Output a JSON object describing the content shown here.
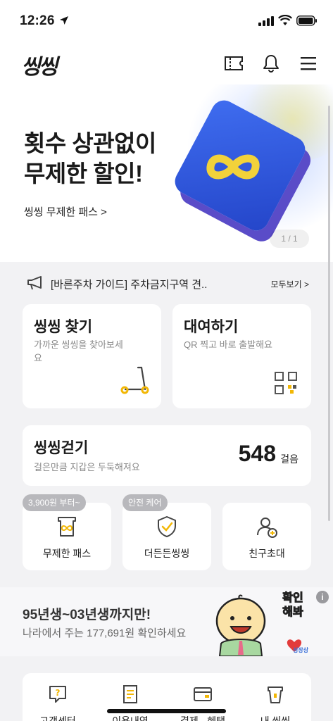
{
  "status_bar": {
    "time": "12:26"
  },
  "header": {
    "logo": "씽씽"
  },
  "banner": {
    "title_line1": "횟수 상관없이",
    "title_line2": "무제한 할인!",
    "link": "씽씽 무제한 패스 >",
    "pager": "1 / 1"
  },
  "notice": {
    "text": "[바른주차 가이드] 주차금지구역 견..",
    "view_all": "모두보기 >"
  },
  "cards": {
    "find": {
      "title": "씽씽 찾기",
      "desc": "가까운 씽씽을 찾아보세요"
    },
    "rent": {
      "title": "대여하기",
      "desc": "QR 찍고 바로 출발해요"
    }
  },
  "walk": {
    "title": "씽씽걷기",
    "desc": "걸은만큼 지갑은 두둑해져요",
    "steps": "548",
    "unit": "걸음"
  },
  "quick": [
    {
      "tag": "3,900원 부터~",
      "label": "무제한 패스"
    },
    {
      "tag": "안전 케어",
      "label": "더든든씽씽"
    },
    {
      "tag": "",
      "label": "친구초대"
    }
  ],
  "ad": {
    "title": "95년생~03년생까지만!",
    "subtitle": "나라에서 주는 177,691원 확인하세요",
    "sticker_text": "확인해봐",
    "sticker_brand": "성장상"
  },
  "bottom_menu": [
    {
      "label": "고객센터"
    },
    {
      "label": "이용내역"
    },
    {
      "label": "결제 · 혜택"
    },
    {
      "label": "내 씽씽"
    }
  ],
  "colors": {
    "accent_yellow": "#f2b705",
    "banner_blue": "#2f5be6"
  }
}
